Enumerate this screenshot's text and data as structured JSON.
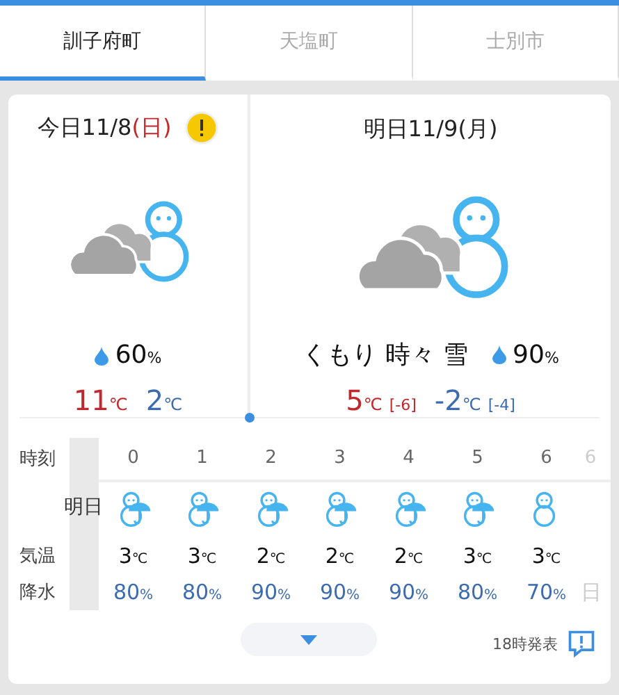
{
  "tabs": [
    {
      "label": "訓子府町",
      "selected": true
    },
    {
      "label": "天塩町",
      "selected": false
    },
    {
      "label": "士別市",
      "selected": false
    }
  ],
  "days": [
    {
      "prefix": "今日11/8",
      "weekday": "(日)",
      "holiday": true,
      "warning": true,
      "rain": "60",
      "high": "11",
      "low": "2"
    },
    {
      "prefix": "明日11/9",
      "weekday": "(月)",
      "holiday": false,
      "warning": false,
      "weather": "くもり 時々 雪",
      "rain": "90",
      "high": "5",
      "low": "-2",
      "high_diff": "[-6]",
      "low_diff": "[-4]"
    }
  ],
  "hourly": {
    "labels": {
      "hour": "時刻",
      "temp": "気温",
      "rain": "降水"
    },
    "date_label": "明日",
    "hours": [
      {
        "hour": "0",
        "kind": "snow_umbrella",
        "temp": "3",
        "rain": "80"
      },
      {
        "hour": "1",
        "kind": "snow_umbrella",
        "temp": "3",
        "rain": "80"
      },
      {
        "hour": "2",
        "kind": "snow_umbrella",
        "temp": "2",
        "rain": "90"
      },
      {
        "hour": "3",
        "kind": "snow_umbrella",
        "temp": "2",
        "rain": "90"
      },
      {
        "hour": "4",
        "kind": "snow_umbrella",
        "temp": "2",
        "rain": "90"
      },
      {
        "hour": "5",
        "kind": "snow_umbrella",
        "temp": "3",
        "rain": "80"
      },
      {
        "hour": "6",
        "kind": "snow",
        "temp": "3",
        "rain": "70"
      }
    ],
    "edge_column": {
      "hour": "6",
      "rain": "日"
    }
  },
  "unit_c": "℃",
  "unit_pct": "%",
  "issued": "18時発表"
}
